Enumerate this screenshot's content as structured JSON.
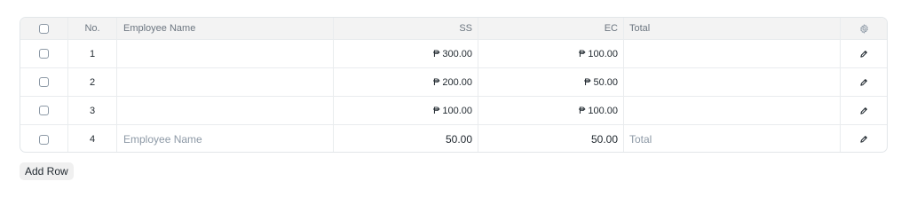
{
  "table": {
    "headers": {
      "no": "No.",
      "employee_name": "Employee Name",
      "ss": "SS",
      "ec": "EC",
      "total": "Total"
    },
    "rows": [
      {
        "no": "1",
        "employee_name": "",
        "ss": "₱ 300.00",
        "ec": "₱ 100.00",
        "total": ""
      },
      {
        "no": "2",
        "employee_name": "",
        "ss": "₱ 200.00",
        "ec": "₱ 50.00",
        "total": ""
      },
      {
        "no": "3",
        "employee_name": "",
        "ss": "₱ 100.00",
        "ec": "₱ 100.00",
        "total": ""
      }
    ],
    "new_row": {
      "no": "4",
      "employee_name_placeholder": "Employee Name",
      "ss": "50.00",
      "ec": "50.00",
      "total_placeholder": "Total"
    }
  },
  "actions": {
    "add_row_label": "Add Row"
  },
  "icons": {
    "settings": "gear-icon",
    "edit": "pencil-icon"
  },
  "colors": {
    "header_bg": "#f3f3f3",
    "border": "#e2e6e9",
    "muted_text": "#8d99a6",
    "text": "#1f272e",
    "button_bg": "#f0f0f0"
  }
}
